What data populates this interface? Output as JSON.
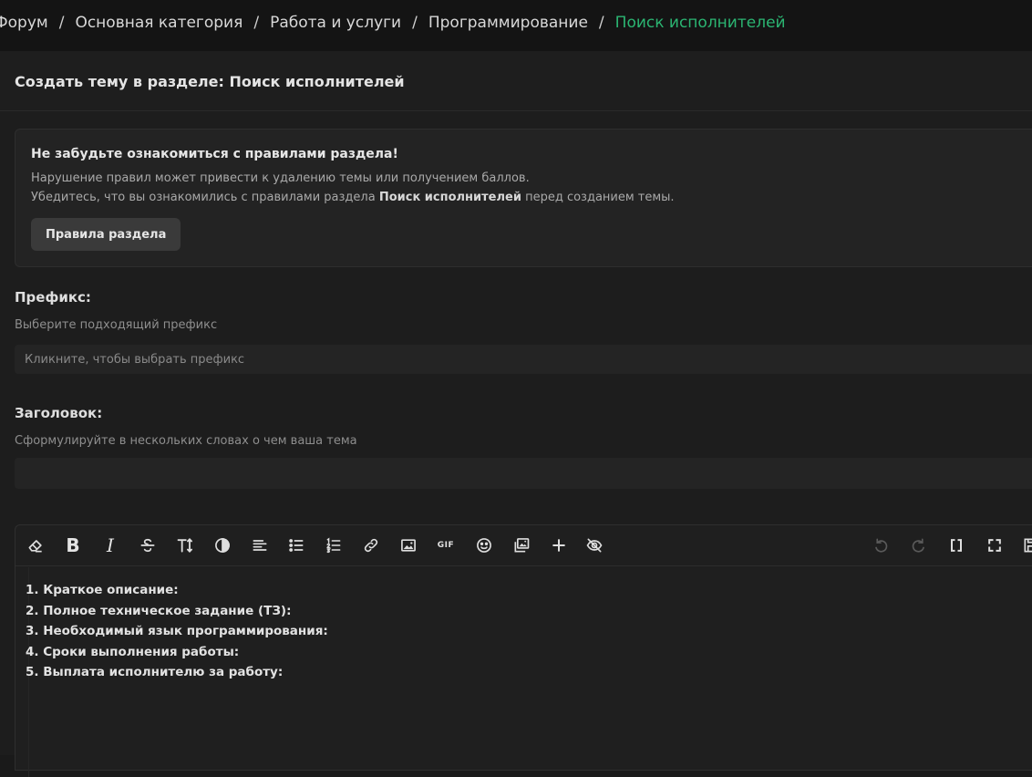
{
  "breadcrumb": {
    "items": [
      "Форум",
      "Основная категория",
      "Работа и услуги",
      "Программирование"
    ],
    "current": "Поиск исполнителей",
    "separator": "/"
  },
  "page": {
    "title": "Создать тему в разделе: Поиск исполнителей"
  },
  "notice": {
    "title": "Не забудьте ознакомиться с правилами раздела!",
    "line1": "Нарушение правил может привести к удалению темы или получением баллов.",
    "line2_before": "Убедитесь, что вы ознакомились с правилами раздела ",
    "line2_bold": "Поиск исполнителей",
    "line2_after": " перед созданием темы.",
    "button": "Правила раздела"
  },
  "prefix": {
    "label": "Префикс:",
    "hint": "Выберите подходящий префикс",
    "placeholder": "Кликните, чтобы выбрать префикс"
  },
  "title_field": {
    "label": "Заголовок:",
    "hint": "Сформулируйте в нескольких словах о чем ваша тема",
    "value": ""
  },
  "editor": {
    "toolbar": {
      "bold": "B",
      "italic": "I",
      "gif": "GIF",
      "icons": [
        "eraser-icon",
        "bold-icon",
        "italic-icon",
        "strikethrough-icon",
        "text-size-icon",
        "color-icon",
        "align-left-icon",
        "bulleted-list-icon",
        "numbered-list-icon",
        "link-icon",
        "image-icon",
        "gif-icon",
        "emoji-icon",
        "media-gallery-icon",
        "plus-icon",
        "hide-icon",
        "undo-icon",
        "redo-icon",
        "bbcode-icon",
        "fullscreen-icon",
        "save-draft-icon"
      ]
    },
    "lines": [
      "1. Краткое описание:",
      "2. Полное техническое задание (ТЗ):",
      "3. Необходимый язык программирования:",
      "4. Сроки выполнения работы:",
      "5. Выплата исполнителю за работу:"
    ]
  },
  "colors": {
    "accent": "#2bb572",
    "background": "#1a1a1a",
    "panel": "#232323"
  }
}
